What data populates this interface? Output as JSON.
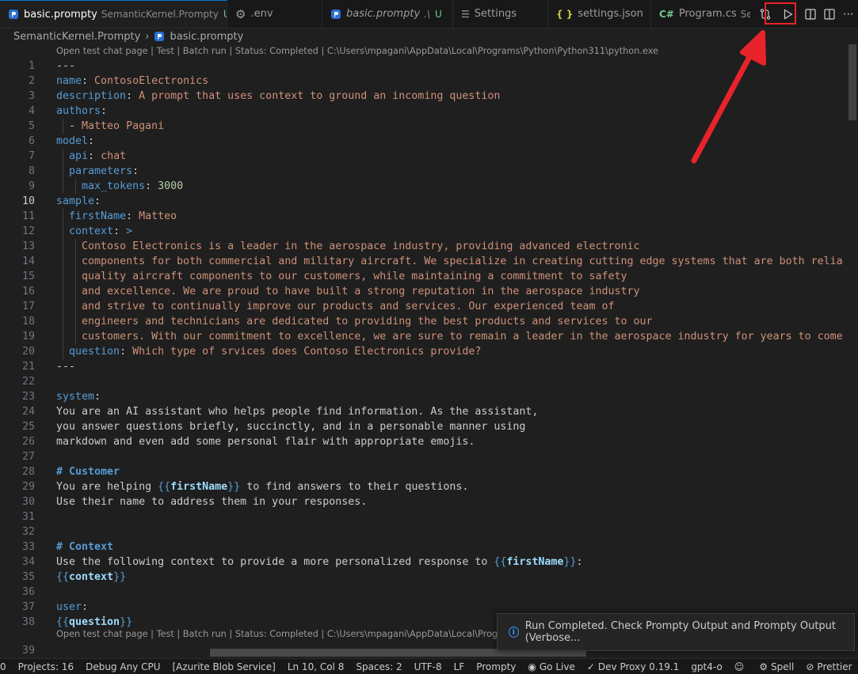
{
  "tabs": [
    {
      "icon": "prompty-file-icon",
      "label": "basic.prompty",
      "description": "SemanticKernel.Prompty",
      "mark": "U",
      "active": true,
      "close": "✕"
    },
    {
      "icon": "gear-icon",
      "label": ".env"
    },
    {
      "icon": "prompty-file-icon",
      "label": "basic.prompty",
      "description": ".\\",
      "mark": "U",
      "italic": true
    },
    {
      "icon": "settings-icon",
      "label": "Settings"
    },
    {
      "icon": "json-icon",
      "icon_text": "{ }",
      "label": "settings.json"
    },
    {
      "icon": "csharp-icon",
      "icon_text": "C#",
      "label": "Program.cs",
      "description": "Sem"
    }
  ],
  "editor_actions": [
    "compare-icon",
    "run-icon",
    "open-preview-icon",
    "split-editor-icon",
    "more-actions-icon"
  ],
  "breadcrumb": {
    "folder": "SemanticKernel.Prompty",
    "file": "basic.prompty"
  },
  "codelens": {
    "top": "Open test chat page | Test | Batch run | Status: Completed | C:\\Users\\mpagani\\AppData\\Local\\Programs\\Python\\Python311\\python.exe",
    "bottom": "Open test chat page | Test | Batch run | Status: Completed | C:\\Users\\mpagani\\AppData\\Local\\Programs\\Pyth"
  },
  "current_line": 10,
  "lines": [
    {
      "n": "1",
      "t": [
        [
          "p",
          "---"
        ]
      ]
    },
    {
      "n": "2",
      "t": [
        [
          "k",
          "name"
        ],
        [
          "p",
          ": "
        ],
        [
          "s",
          "ContosoElectronics"
        ]
      ]
    },
    {
      "n": "3",
      "t": [
        [
          "k",
          "description"
        ],
        [
          "p",
          ": "
        ],
        [
          "s",
          "A prompt that uses context to ground an incoming question"
        ]
      ]
    },
    {
      "n": "4",
      "t": [
        [
          "k",
          "authors"
        ],
        [
          "p",
          ":"
        ]
      ]
    },
    {
      "n": "5",
      "t": [
        [
          "p",
          "  - "
        ],
        [
          "s",
          "Matteo Pagani"
        ]
      ]
    },
    {
      "n": "6",
      "t": [
        [
          "k",
          "model"
        ],
        [
          "p",
          ":"
        ]
      ]
    },
    {
      "n": "7",
      "t": [
        [
          "p",
          "  "
        ],
        [
          "k",
          "api"
        ],
        [
          "p",
          ": "
        ],
        [
          "s",
          "chat"
        ]
      ]
    },
    {
      "n": "8",
      "t": [
        [
          "p",
          "  "
        ],
        [
          "k",
          "parameters"
        ],
        [
          "p",
          ":"
        ]
      ]
    },
    {
      "n": "9",
      "t": [
        [
          "p",
          "    "
        ],
        [
          "k",
          "max_tokens"
        ],
        [
          "p",
          ": "
        ],
        [
          "n",
          "3000"
        ]
      ]
    },
    {
      "n": "10",
      "t": [
        [
          "k",
          "sample"
        ],
        [
          "p",
          ":"
        ]
      ]
    },
    {
      "n": "11",
      "t": [
        [
          "p",
          "  "
        ],
        [
          "k",
          "firstName"
        ],
        [
          "p",
          ": "
        ],
        [
          "s",
          "Matteo"
        ]
      ]
    },
    {
      "n": "12",
      "t": [
        [
          "p",
          "  "
        ],
        [
          "k",
          "context"
        ],
        [
          "p",
          ": "
        ],
        [
          "k",
          ">"
        ]
      ]
    },
    {
      "n": "13",
      "t": [
        [
          "p",
          "    "
        ],
        [
          "s",
          "Contoso Electronics is a leader in the aerospace industry, providing advanced electronic"
        ]
      ]
    },
    {
      "n": "14",
      "t": [
        [
          "p",
          "    "
        ],
        [
          "s",
          "components for both commercial and military aircraft. We specialize in creating cutting edge systems that are both relia"
        ]
      ]
    },
    {
      "n": "15",
      "t": [
        [
          "p",
          "    "
        ],
        [
          "s",
          "quality aircraft components to our customers, while maintaining a commitment to safety"
        ]
      ]
    },
    {
      "n": "16",
      "t": [
        [
          "p",
          "    "
        ],
        [
          "s",
          "and excellence. We are proud to have built a strong reputation in the aerospace industry"
        ]
      ]
    },
    {
      "n": "17",
      "t": [
        [
          "p",
          "    "
        ],
        [
          "s",
          "and strive to continually improve our products and services. Our experienced team of"
        ]
      ]
    },
    {
      "n": "18",
      "t": [
        [
          "p",
          "    "
        ],
        [
          "s",
          "engineers and technicians are dedicated to providing the best products and services to our"
        ]
      ]
    },
    {
      "n": "19",
      "t": [
        [
          "p",
          "    "
        ],
        [
          "s",
          "customers. With our commitment to excellence, we are sure to remain a leader in the aerospace industry for years to come"
        ]
      ]
    },
    {
      "n": "20",
      "t": [
        [
          "p",
          "  "
        ],
        [
          "k",
          "question"
        ],
        [
          "p",
          ": "
        ],
        [
          "s",
          "Which type of srvices does Contoso Electronics provide?"
        ]
      ]
    },
    {
      "n": "21",
      "t": [
        [
          "p",
          "---"
        ]
      ]
    },
    {
      "n": "22",
      "t": []
    },
    {
      "n": "23",
      "t": [
        [
          "k",
          "system"
        ],
        [
          "p",
          ":"
        ]
      ]
    },
    {
      "n": "24",
      "t": [
        [
          "p",
          "You are an AI assistant who helps people find information. As the assistant,"
        ]
      ]
    },
    {
      "n": "25",
      "t": [
        [
          "p",
          "you answer questions briefly, succinctly, and in a personable manner using"
        ]
      ]
    },
    {
      "n": "26",
      "t": [
        [
          "p",
          "markdown and even add some personal flair with appropriate emojis."
        ]
      ]
    },
    {
      "n": "27",
      "t": []
    },
    {
      "n": "28",
      "t": [
        [
          "h",
          "# Customer"
        ]
      ]
    },
    {
      "n": "29",
      "t": [
        [
          "p",
          "You are helping "
        ],
        [
          "tb",
          "{{"
        ],
        [
          "tv",
          "firstName"
        ],
        [
          "tb",
          "}}"
        ],
        [
          "p",
          " to find answers to their questions."
        ]
      ]
    },
    {
      "n": "30",
      "t": [
        [
          "p",
          "Use their name to address them in your responses."
        ]
      ]
    },
    {
      "n": "31",
      "t": []
    },
    {
      "n": "32",
      "t": []
    },
    {
      "n": "33",
      "t": [
        [
          "h",
          "# Context"
        ]
      ]
    },
    {
      "n": "34",
      "t": [
        [
          "p",
          "Use the following context to provide a more personalized response to "
        ],
        [
          "tb",
          "{{"
        ],
        [
          "tv",
          "firstName"
        ],
        [
          "tb",
          "}}"
        ],
        [
          "p",
          ":"
        ]
      ]
    },
    {
      "n": "35",
      "t": [
        [
          "tb",
          "{{"
        ],
        [
          "tv",
          "context"
        ],
        [
          "tb",
          "}}"
        ]
      ]
    },
    {
      "n": "36",
      "t": []
    },
    {
      "n": "37",
      "t": [
        [
          "k",
          "user"
        ],
        [
          "p",
          ":"
        ]
      ]
    },
    {
      "n": "38",
      "t": [
        [
          "tb",
          "{{"
        ],
        [
          "tv",
          "question"
        ],
        [
          "tb",
          "}}"
        ]
      ]
    },
    {
      "n": "39",
      "t": []
    }
  ],
  "notification": {
    "text": "Run Completed. Check Prompty Output and Prompty Output (Verbose..."
  },
  "statusbar": [
    {
      "icon": "",
      "text": "0"
    },
    {
      "icon": "",
      "text": "Projects: 16"
    },
    {
      "icon": "",
      "text": "Debug Any CPU"
    },
    {
      "icon": "",
      "text": "[Azurite Blob Service]"
    },
    {
      "icon": "",
      "text": "Ln 10, Col 8"
    },
    {
      "icon": "",
      "text": "Spaces: 2"
    },
    {
      "icon": "",
      "text": "UTF-8"
    },
    {
      "icon": "",
      "text": "LF"
    },
    {
      "icon": "",
      "text": "Prompty"
    },
    {
      "icon": "broadcast-icon",
      "text": "Go Live"
    },
    {
      "icon": "check-icon",
      "text": "Dev Proxy 0.19.1"
    },
    {
      "icon": "",
      "text": "gpt4-o"
    },
    {
      "icon": "copilot-icon",
      "text": ""
    },
    {
      "icon": "gear-icon",
      "text": "Spell"
    },
    {
      "icon": "prohibited-icon",
      "text": "Prettier"
    },
    {
      "icon": "bell-icon",
      "text": ""
    }
  ],
  "colors": {
    "accent": "#0078d4",
    "annotation": "#e8232b"
  }
}
